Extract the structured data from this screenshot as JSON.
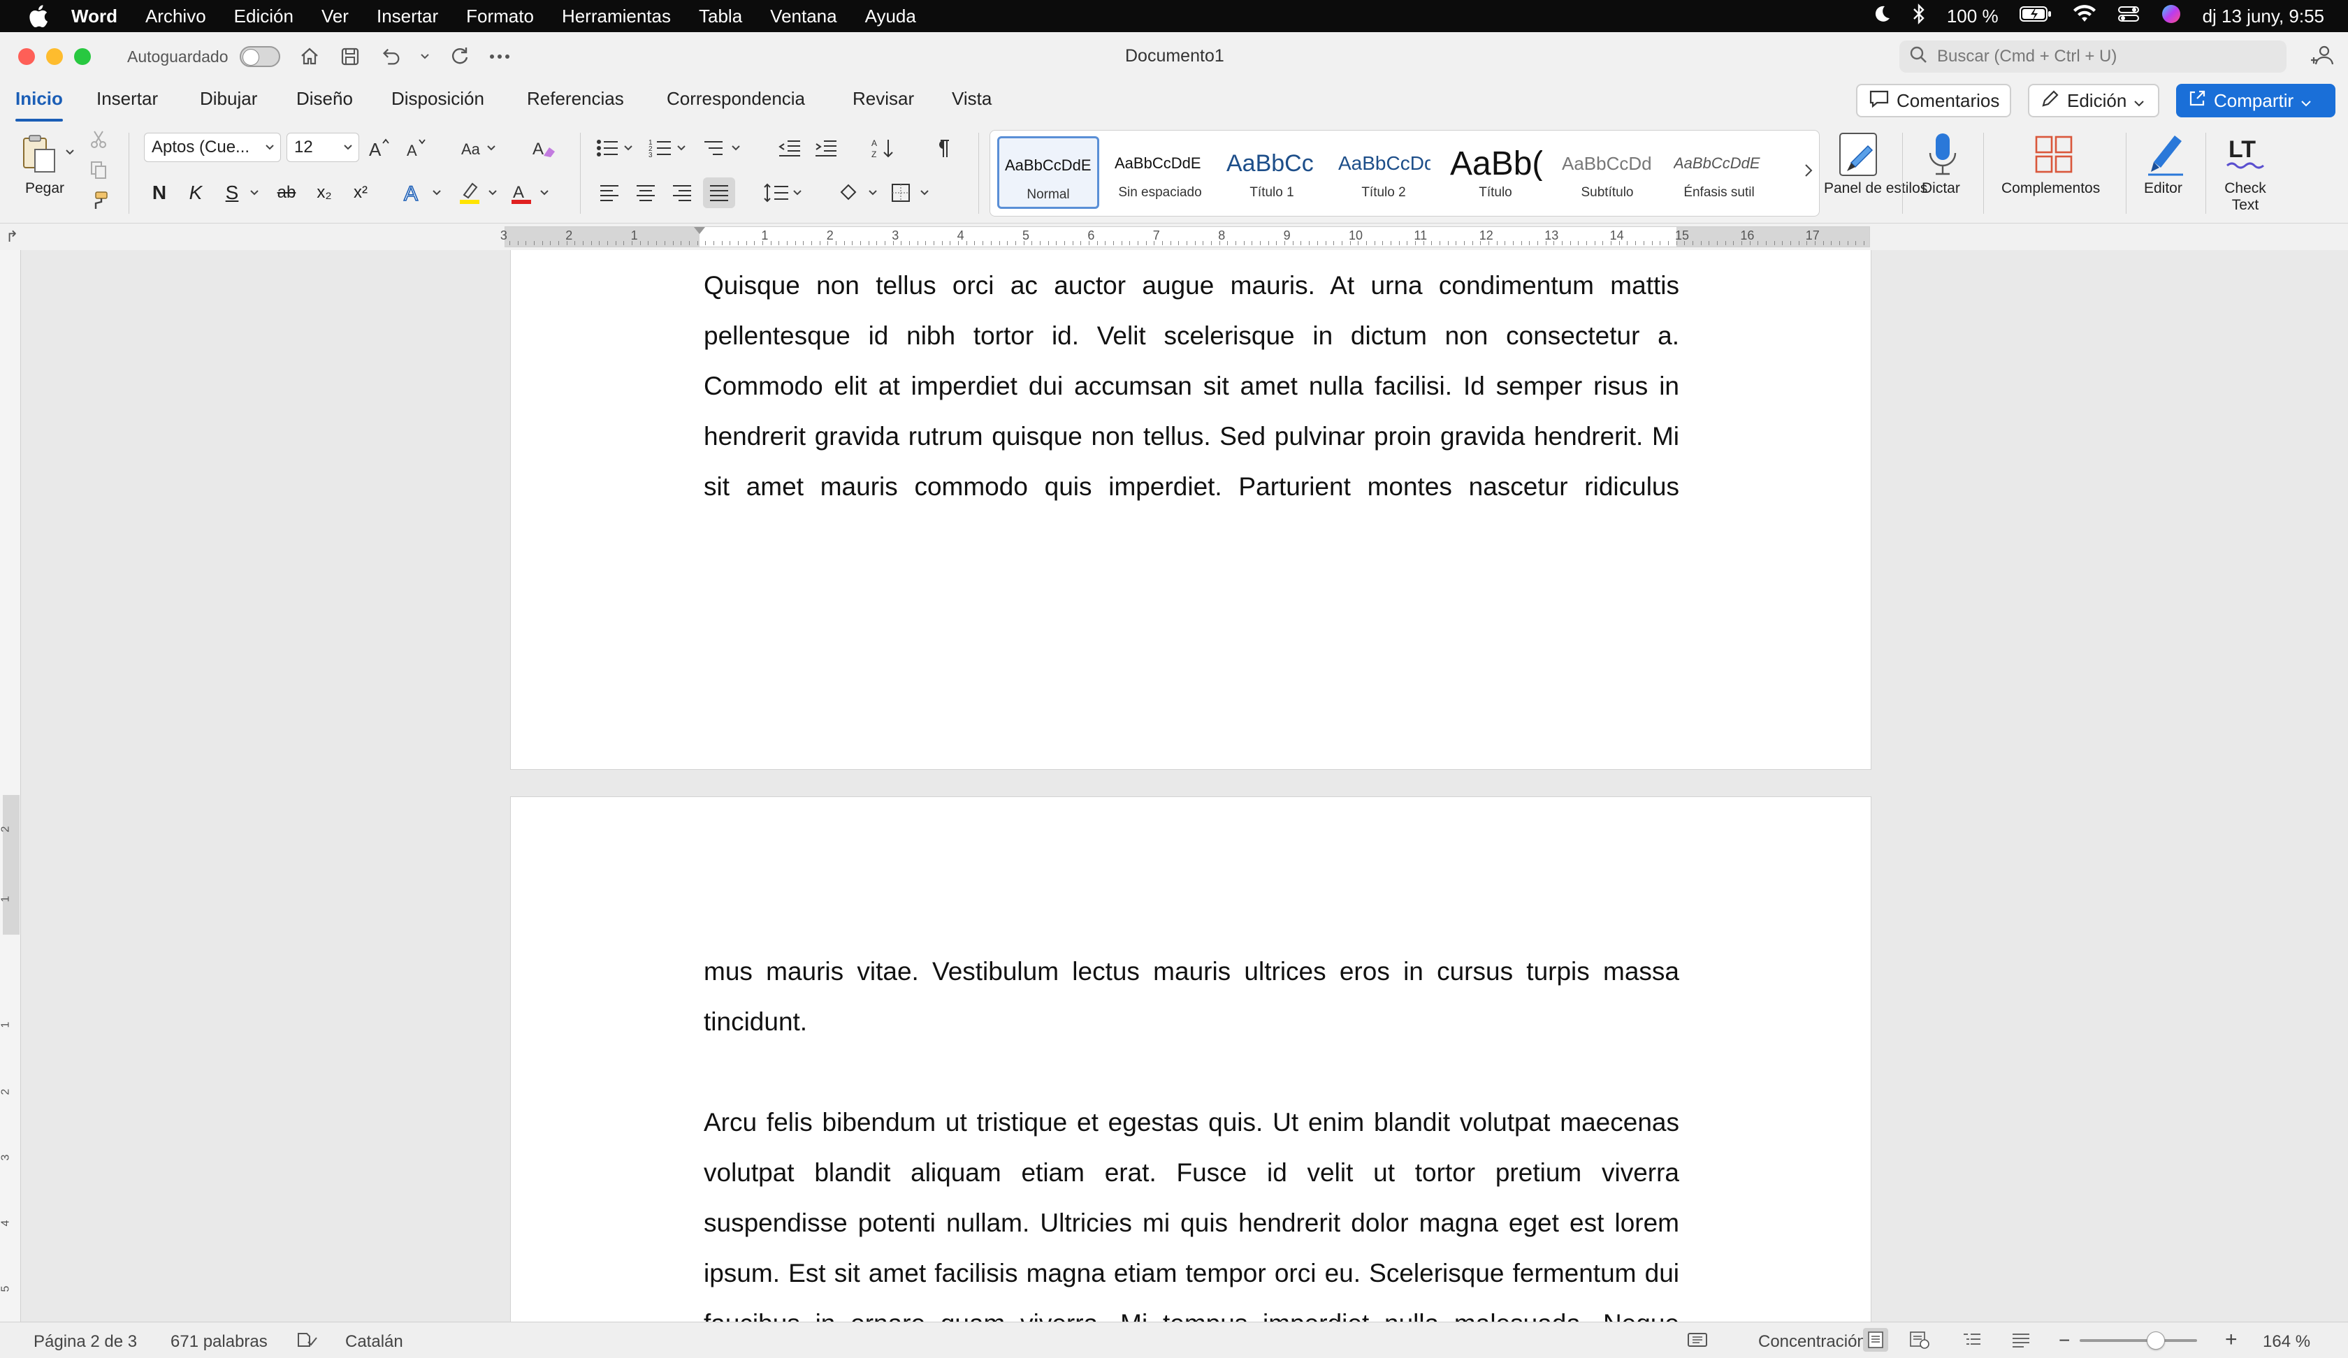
{
  "menubar": {
    "app": "Word",
    "items": [
      "Archivo",
      "Edición",
      "Ver",
      "Insertar",
      "Formato",
      "Herramientas",
      "Tabla",
      "Ventana",
      "Ayuda"
    ],
    "battery": "100 %",
    "datetime": "dj 13 juny, 9:55"
  },
  "titlebar": {
    "autosave": "Autoguardado",
    "title": "Documento1",
    "search_placeholder": "Buscar (Cmd + Ctrl + U)"
  },
  "tabs": [
    "Inicio",
    "Insertar",
    "Dibujar",
    "Diseño",
    "Disposición",
    "Referencias",
    "Correspondencia",
    "Revisar",
    "Vista"
  ],
  "ribbon_actions": {
    "comments": "Comentarios",
    "editing": "Edición",
    "share": "Compartir"
  },
  "ribbon": {
    "paste": "Pegar",
    "font": "Aptos (Cue...",
    "size": "12",
    "bold": "N",
    "italic": "K",
    "underline": "S",
    "strike": "ab",
    "subscript": "x₂",
    "superscript": "x²",
    "styles": [
      {
        "sample": "AaBbCcDdE",
        "name": "Normal"
      },
      {
        "sample": "AaBbCcDdE",
        "name": "Sin espaciado"
      },
      {
        "sample": "AaBbCc",
        "name": "Título 1"
      },
      {
        "sample": "AaBbCcDd",
        "name": "Título 2"
      },
      {
        "sample": "AaBb(",
        "name": "Título"
      },
      {
        "sample": "AaBbCcDd",
        "name": "Subtítulo"
      },
      {
        "sample": "AaBbCcDdE",
        "name": "Énfasis sutil"
      }
    ],
    "styles_pane": "Panel de estilos",
    "dictate": "Dictar",
    "addins": "Complementos",
    "editor": "Editor",
    "checktext": "Check Text",
    "lt_logo": "LT"
  },
  "ruler": {
    "numbers": [
      "3",
      "2",
      "1",
      "1",
      "2",
      "3",
      "4",
      "5",
      "6",
      "7",
      "8",
      "9",
      "10",
      "11",
      "12",
      "13",
      "14",
      "15",
      "16",
      "17"
    ],
    "vnumbers": [
      "2",
      "1",
      "1",
      "2",
      "3",
      "4",
      "5"
    ]
  },
  "document": {
    "page1_para": "Quisque non tellus orci ac auctor augue mauris. At urna condimentum mattis pellentesque id nibh tortor id. Velit scelerisque in dictum non consectetur a. Commodo elit at imperdiet dui accumsan sit amet nulla facilisi. Id semper risus in hendrerit gravida rutrum quisque non tellus. Sed pulvinar proin gravida hendrerit. Mi sit amet mauris commodo quis imperdiet. Parturient montes nascetur ridiculus",
    "page2_para1": "mus mauris vitae. Vestibulum lectus mauris ultrices eros in cursus turpis massa tincidunt.",
    "page2_para2": "Arcu felis bibendum ut tristique et egestas quis. Ut enim blandit volutpat maecenas volutpat blandit aliquam etiam erat. Fusce id velit ut tortor pretium viverra suspendisse potenti nullam. Ultricies mi quis hendrerit dolor magna eget est lorem ipsum. Est sit amet facilisis magna etiam tempor orci eu. Scelerisque fermentum dui faucibus in ornare quam viverra. Mi tempus imperdiet nulla malesuada. Neque"
  },
  "statusbar": {
    "page": "Página 2 de 3",
    "words": "671 palabras",
    "language": "Catalán",
    "focus": "Concentración",
    "zoom": "164 %",
    "zoom_fraction": 0.55
  },
  "colors": {
    "accent": "#1b5eb6",
    "share_button": "#1a6fd8",
    "close": "#fe5f57",
    "minimize": "#febc2e",
    "maximize": "#28c840"
  }
}
